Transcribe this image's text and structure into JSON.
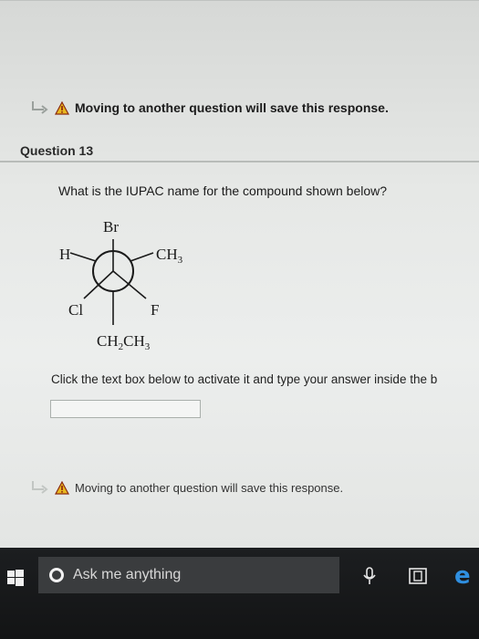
{
  "notice": {
    "text": "Moving to another question will save this response."
  },
  "question": {
    "header": "Question 13",
    "prompt": "What is the IUPAC name for the compound shown below?",
    "molecule": {
      "front_top": "Br",
      "front_left_bottom": "Cl",
      "front_right_bottom": "F",
      "back_left": "H",
      "back_right_main": "CH",
      "back_right_sub": "3",
      "bottom_parts": [
        "CH",
        "2",
        "CH",
        "3"
      ]
    },
    "instruction": "Click the text box below to activate it and type your answer inside the b",
    "answer_value": ""
  },
  "taskbar": {
    "search_placeholder": "Ask me anything",
    "icons": [
      "windows-start-icon",
      "search-circle-icon",
      "microphone-icon",
      "task-view-icon",
      "edge-browser-icon"
    ],
    "edge_glyph": "e"
  }
}
